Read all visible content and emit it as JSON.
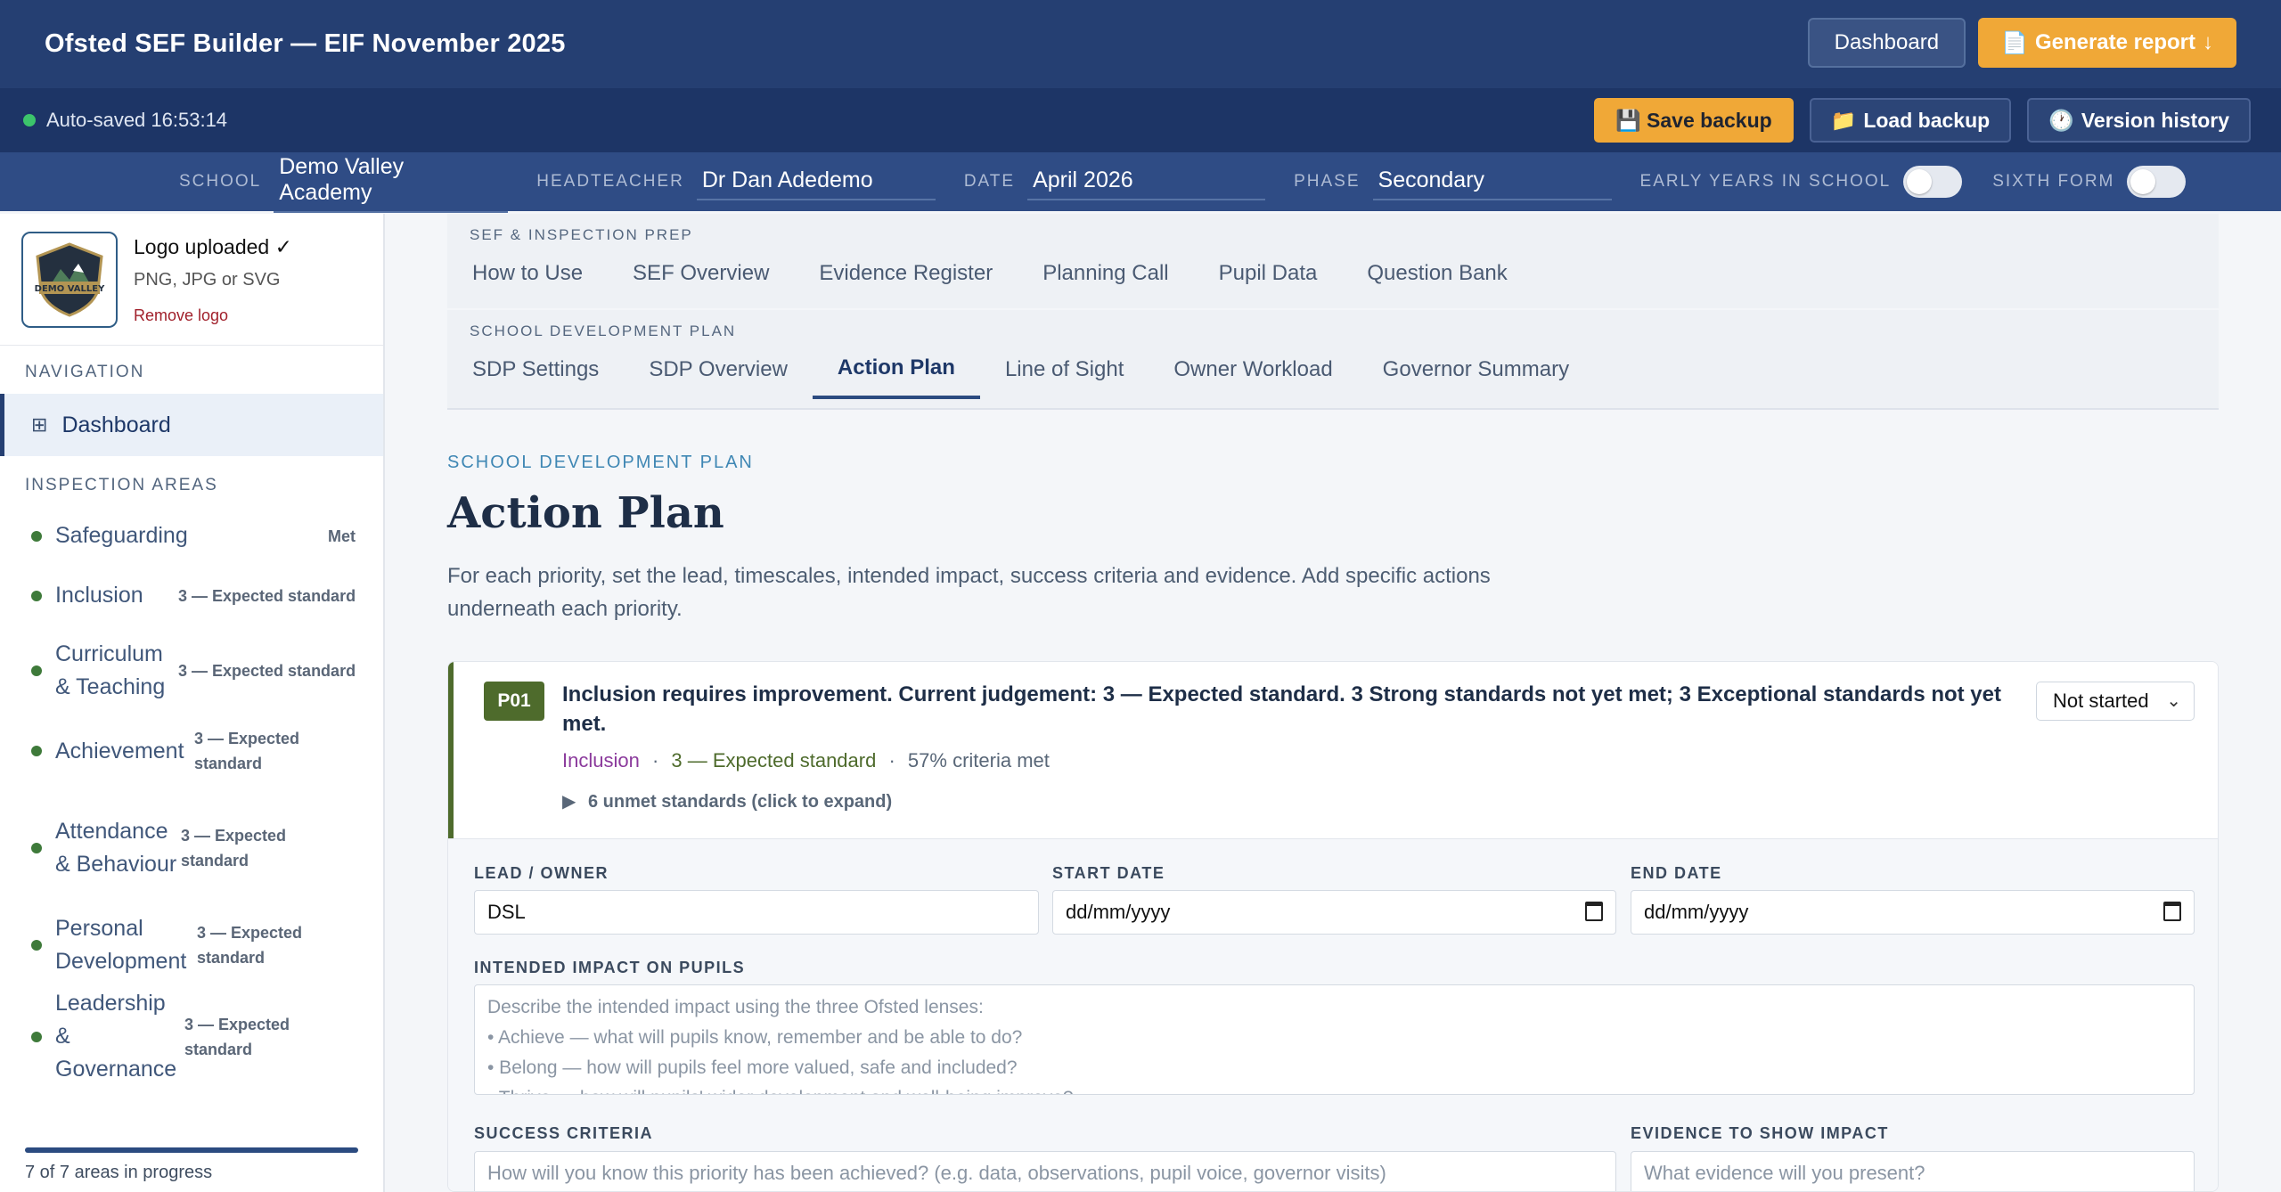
{
  "header": {
    "app_title": "Ofsted SEF Builder — EIF November 2025",
    "dashboard_label": "Dashboard",
    "generate_label": "Generate report",
    "generate_icon": "📄",
    "generate_arrow": "↓"
  },
  "savebar": {
    "autosave_text": "Auto-saved 16:53:14",
    "save_backup_label": "Save backup",
    "save_backup_icon": "💾",
    "load_backup_label": "Load backup",
    "load_backup_icon": "📁",
    "version_history_label": "Version history",
    "version_history_icon": "🕐"
  },
  "school_info": {
    "school_label": "SCHOOL",
    "school_value": "Demo Valley Academy",
    "headteacher_label": "HEADTEACHER",
    "headteacher_value": "Dr Dan Adedemo",
    "date_label": "DATE",
    "date_value": "April 2026",
    "phase_label": "PHASE",
    "phase_value": "Secondary",
    "early_years_label": "EARLY YEARS IN SCHOOL",
    "sixth_form_label": "SIXTH FORM"
  },
  "sidebar": {
    "logo_status": "Logo uploaded ✓",
    "logo_types": "PNG, JPG or SVG",
    "logo_remove": "Remove logo",
    "logo_text": "DEMO VALLEY",
    "navigation_heading": "NAVIGATION",
    "dashboard_label": "Dashboard",
    "inspection_heading": "INSPECTION AREAS",
    "areas": [
      {
        "name": "Safeguarding",
        "status": "Met"
      },
      {
        "name": "Inclusion",
        "status": "3 — Expected standard"
      },
      {
        "name": "Curriculum & Teaching",
        "status": "3 — Expected standard"
      },
      {
        "name": "Achievement",
        "status": "3 — Expected standard"
      },
      {
        "name": "Attendance & Behaviour",
        "status": "3 — Expected standard"
      },
      {
        "name": "Personal Development",
        "status": "3 — Expected standard"
      },
      {
        "name": "Leadership & Governance",
        "status": "3 — Expected standard"
      }
    ],
    "progress_fraction": 1.0,
    "progress_text": "7 of 7 areas in progress"
  },
  "tabs": {
    "section1_label": "SEF & INSPECTION PREP",
    "section1": [
      "How to Use",
      "SEF Overview",
      "Evidence Register",
      "Planning Call",
      "Pupil Data",
      "Question Bank"
    ],
    "section2_label": "SCHOOL DEVELOPMENT PLAN",
    "section2": [
      "SDP Settings",
      "SDP Overview",
      "Action Plan",
      "Line of Sight",
      "Owner Workload",
      "Governor Summary"
    ],
    "active": "Action Plan"
  },
  "page": {
    "eyebrow": "SCHOOL DEVELOPMENT PLAN",
    "title": "Action Plan",
    "description": "For each priority, set the lead, timescales, intended impact, success criteria and evidence. Add specific actions underneath each priority."
  },
  "priority": {
    "id": "P01",
    "title": "Inclusion requires improvement. Current judgement: 3 — Expected standard. 3 Strong standards not yet met; 3 Exceptional standards not yet met.",
    "area": "Inclusion",
    "judgement": "3 — Expected standard",
    "criteria": "57% criteria met",
    "separator": "·",
    "expand_text": "6 unmet standards (click to expand)",
    "status": "Not started",
    "lead_label": "LEAD / OWNER",
    "lead_value": "DSL",
    "start_label": "START DATE",
    "start_placeholder": "dd/mm/yyyy",
    "end_label": "END DATE",
    "end_placeholder": "dd/mm/yyyy",
    "impact_label": "INTENDED IMPACT ON PUPILS",
    "impact_placeholder": "Describe the intended impact using the three Ofsted lenses:\n• Achieve — what will pupils know, remember and be able to do?\n• Belong — how will pupils feel more valued, safe and included?\n• Thrive — how will pupils' wider development and well-being improve?",
    "success_label": "SUCCESS CRITERIA",
    "success_placeholder": "How will you know this priority has been achieved? (e.g. data, observations, pupil voice, governor visits)",
    "evidence_label": "EVIDENCE TO SHOW IMPACT",
    "evidence_placeholder": "What evidence will you present?"
  },
  "colors": {
    "header_bg": "#253f72",
    "accent_orange": "#f0a837",
    "priority_green": "#4e6b2c",
    "area_purple": "#8b3a9c"
  }
}
